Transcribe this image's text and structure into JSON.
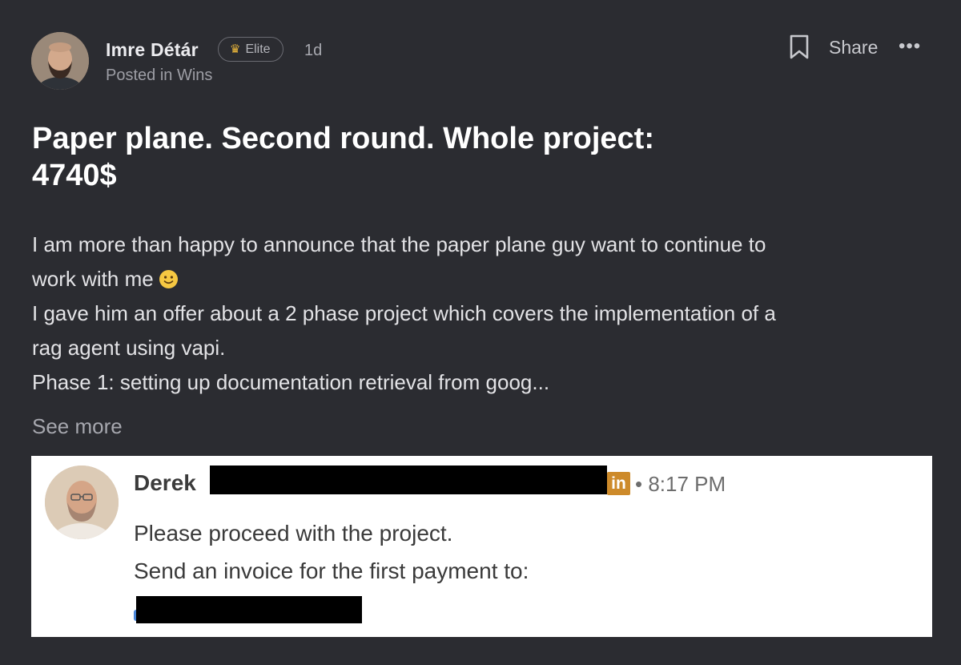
{
  "post": {
    "author": "Imre Détár",
    "badge": "Elite",
    "badge_icon": "crown-icon",
    "age": "1d",
    "posted_in_prefix": "Posted in",
    "category": "Wins",
    "share_label": "Share",
    "more_label": "•••",
    "title_line1": "Paper plane. Second round. Whole project:",
    "title_line2": "4740$",
    "body_lines": [
      "I am more than happy to announce that the paper plane guy want to continue to",
      "work with me",
      "I gave him an offer about a 2 phase project which covers the implementation of a",
      "rag agent using vapi.",
      "Phase 1: setting up documentation retrieval from goog..."
    ],
    "see_more": "See more"
  },
  "attachment": {
    "sender": "Derek",
    "linkedin_badge": "in",
    "time": "• 8:17 PM",
    "line1": "Please proceed with the project.",
    "line2": "Send an invoice for the first payment to:"
  },
  "colors": {
    "background": "#2b2c31",
    "title": "#ffffff",
    "muted": "#9d9ea5",
    "linkedin_badge": "#cd8a2a"
  }
}
